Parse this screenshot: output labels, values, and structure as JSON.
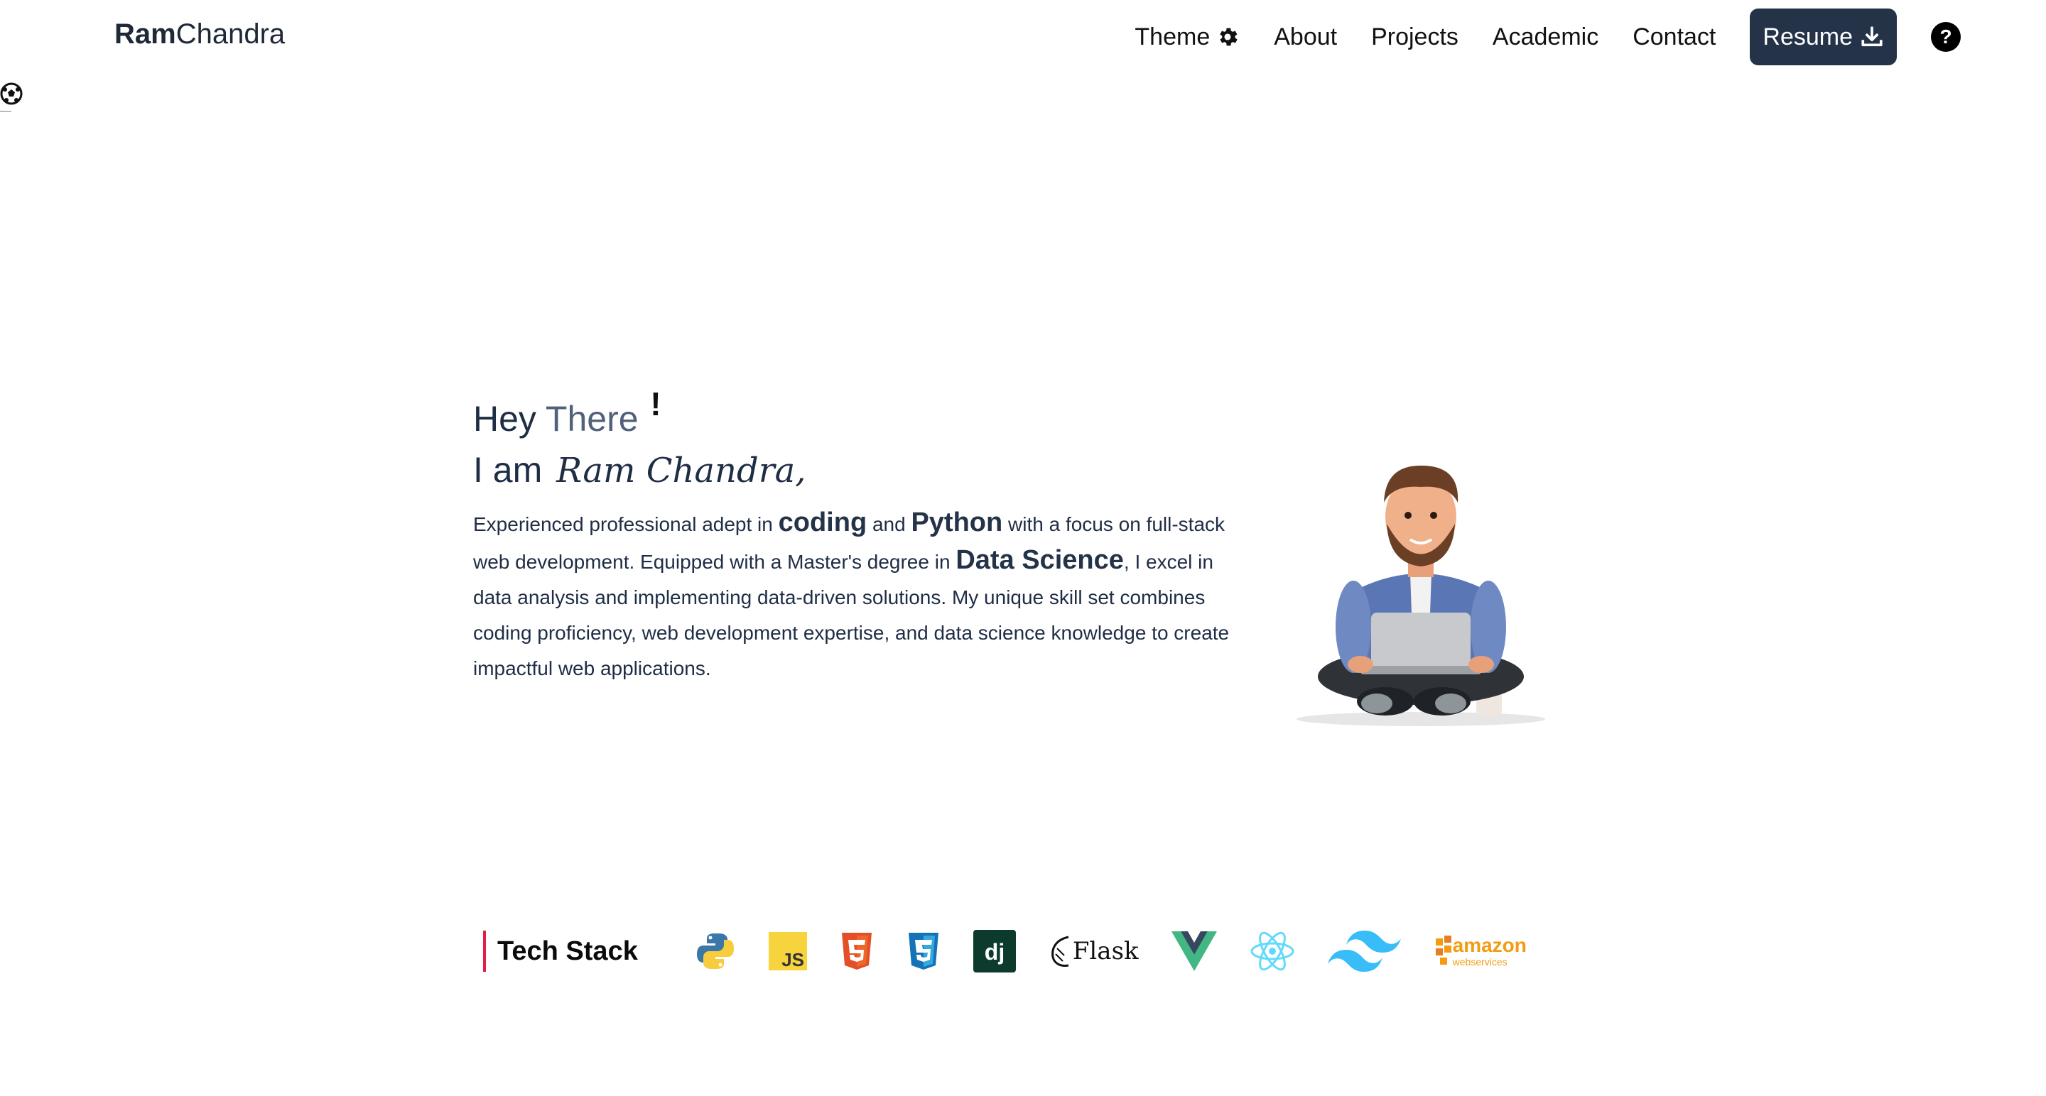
{
  "brand": {
    "bold": "Ram",
    "rest": "Chandra"
  },
  "nav": {
    "theme_label": "Theme",
    "about_label": "About",
    "projects_label": "Projects",
    "academic_label": "Academic",
    "contact_label": "Contact",
    "resume_label": "Resume",
    "help_symbol": "?"
  },
  "hero": {
    "greeting_1": "Hey",
    "greeting_2": "There",
    "greeting_bang": "!",
    "intro_prefix": "I am",
    "name_script": "Ram Chandra,",
    "about": {
      "t1": "Experienced professional adept in ",
      "h1": "coding",
      "t2": " and ",
      "h2": "Python",
      "t3": " with a focus on full-stack web development. Equipped with a Master's degree in ",
      "h3": "Data Science",
      "t4": ", I excel in data analysis and implementing data-driven solutions. My unique skill set combines coding proficiency, web development expertise, and data science knowledge to create impactful web applications."
    }
  },
  "tech_stack": {
    "title": "Tech Stack",
    "icons": [
      "python-icon",
      "javascript-icon",
      "html5-icon",
      "css3-icon",
      "django-icon",
      "flask-icon",
      "vue-icon",
      "react-icon",
      "tailwind-icon",
      "aws-icon"
    ],
    "js_label": "JS",
    "dj_label": "dj",
    "flask_label": "Flask",
    "aws_label": "amazon",
    "aws_sub": "webservices"
  },
  "colors": {
    "accent": "#253349",
    "text": "#1f2d45",
    "tech_bar": "#e11d48"
  }
}
